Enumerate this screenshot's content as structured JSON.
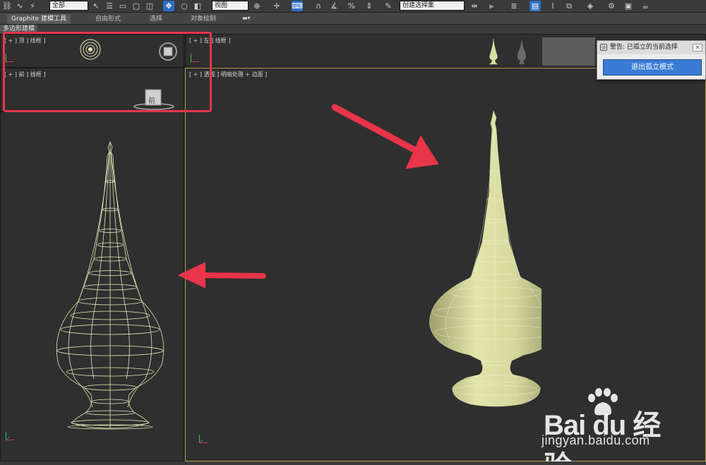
{
  "toolbar": {
    "select_filter": "全部",
    "view_dropdown": "视图",
    "named_selection": "创建选择集"
  },
  "ribbon": {
    "tabs": [
      "Graphite 建模工具",
      "自由形式",
      "选择",
      "对象绘制"
    ],
    "active_tab": "Graphite 建模工具",
    "panel_label": "多边形建模"
  },
  "viewports": {
    "top": "[ + ] 顶 ] 线框 ]",
    "left": "[ + ] 左 ] 线框 ]",
    "front": "[ + ] 前 ] 线框 ]",
    "perspective": "[ + ] 透视 ] 明暗处理 + 边面 ]",
    "front_cube_label": "前"
  },
  "dialog": {
    "title": "警告: 已孤立的当前选择",
    "button": "退出孤立模式"
  },
  "watermark": {
    "brand": "Bai du 经验",
    "url": "jingyan.baidu.com"
  },
  "colors": {
    "highlight": "#e8354a",
    "model": "#d9dda0",
    "wireframe": "#e6e8b8",
    "active_border": "#b8a24a"
  }
}
